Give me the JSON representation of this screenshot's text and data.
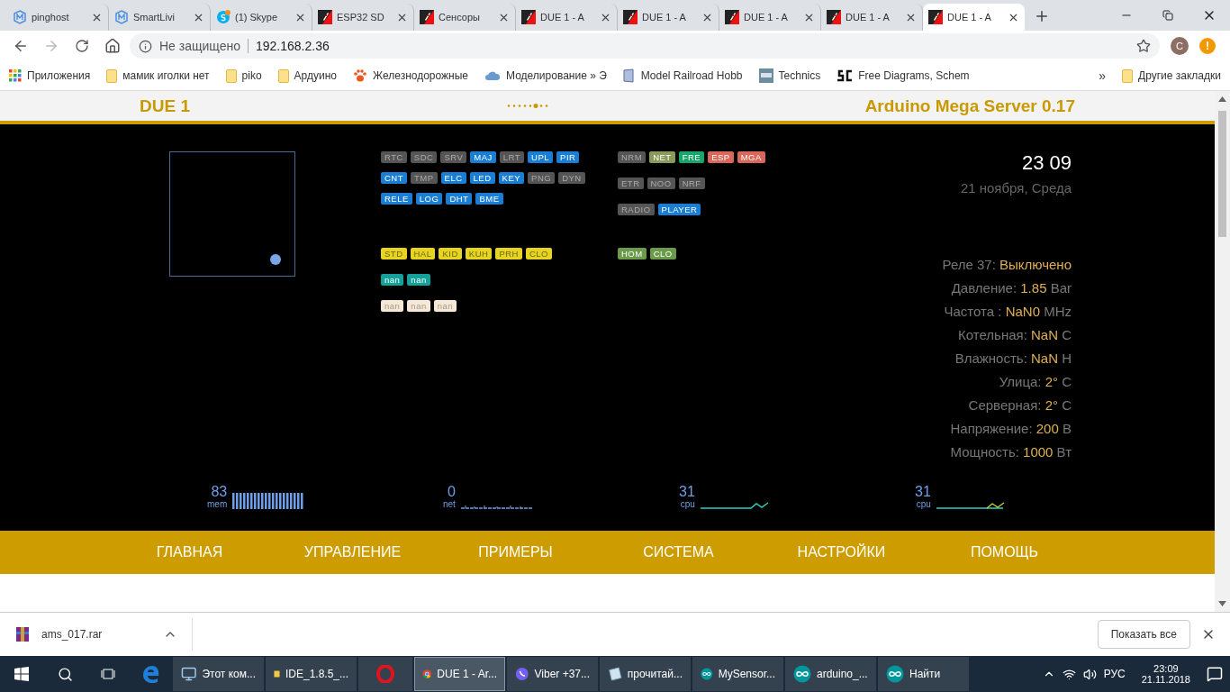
{
  "browser": {
    "tabs": [
      {
        "title": "pinghost",
        "kind": "m",
        "selected": false
      },
      {
        "title": "SmartLivi",
        "kind": "m",
        "selected": false
      },
      {
        "title": "(1) Skype",
        "kind": "skype",
        "selected": false
      },
      {
        "title": "ESP32 SD",
        "kind": "ams",
        "selected": false
      },
      {
        "title": "Сенсоры",
        "kind": "ams",
        "selected": false
      },
      {
        "title": "DUE 1 - A",
        "kind": "ams",
        "selected": false
      },
      {
        "title": "DUE 1 - A",
        "kind": "ams",
        "selected": false
      },
      {
        "title": "DUE 1 - A",
        "kind": "ams",
        "selected": false
      },
      {
        "title": "DUE 1 - A",
        "kind": "ams",
        "selected": false
      },
      {
        "title": "DUE 1 - A",
        "kind": "ams",
        "selected": true
      }
    ],
    "security": "Не защищено",
    "url": "192.168.2.36",
    "avatar": "C",
    "alert": "!",
    "bookmarks": [
      {
        "label": "Приложения",
        "kind": "apps"
      },
      {
        "label": "мамик иголки нет",
        "kind": "folder"
      },
      {
        "label": "piko",
        "kind": "folder"
      },
      {
        "label": "Ардуино",
        "kind": "folder"
      },
      {
        "label": "Железнодорожные",
        "kind": "paw"
      },
      {
        "label": "Моделирование » Э",
        "kind": "cloud"
      },
      {
        "label": "Model Railroad Hobb",
        "kind": "doc"
      },
      {
        "label": "Technics",
        "kind": "tac"
      },
      {
        "label": "Free Diagrams, Schem",
        "kind": "sc"
      }
    ],
    "more_bookmarks": "»",
    "other_bookmarks": "Другие закладки"
  },
  "page": {
    "header": {
      "left": "DUE 1",
      "right": "Arduino Mega Server 0.17"
    },
    "left_badges": {
      "status_rows": [
        [
          {
            "label": "RTC",
            "color": "#555555"
          },
          {
            "label": "SDC",
            "color": "#555555"
          },
          {
            "label": "SRV",
            "color": "#555555"
          },
          {
            "label": "MAJ",
            "color": "#1a7fd4"
          },
          {
            "label": "LRT",
            "color": "#555555"
          },
          {
            "label": "UPL",
            "color": "#1a7fd4"
          },
          {
            "label": "PIR",
            "color": "#1a7fd4"
          }
        ],
        [
          {
            "label": "CNT",
            "color": "#1a7fd4"
          },
          {
            "label": "TMP",
            "color": "#555555"
          },
          {
            "label": "ELC",
            "color": "#1a7fd4"
          },
          {
            "label": "LED",
            "color": "#1a7fd4"
          },
          {
            "label": "KEY",
            "color": "#1a7fd4"
          },
          {
            "label": "PNG",
            "color": "#555555"
          },
          {
            "label": "DYN",
            "color": "#555555"
          }
        ],
        [
          {
            "label": "RELE",
            "color": "#1a7fd4"
          },
          {
            "label": "LOG",
            "color": "#1a7fd4"
          },
          {
            "label": "DHT",
            "color": "#1a7fd4"
          },
          {
            "label": "BME",
            "color": "#1a7fd4"
          }
        ]
      ],
      "sensor_rows": [
        [
          {
            "label": "STD",
            "color": "#e6d420"
          },
          {
            "label": "HAL",
            "color": "#e6d420"
          },
          {
            "label": "KID",
            "color": "#e6d420"
          },
          {
            "label": "KUH",
            "color": "#e6d420"
          },
          {
            "label": "PRH",
            "color": "#e6d420"
          },
          {
            "label": "CLO",
            "color": "#e6d420"
          }
        ],
        [
          {
            "label": "nan",
            "color": "#13a19a"
          },
          {
            "label": "nan",
            "color": "#13a19a"
          }
        ],
        [
          {
            "label": "nan",
            "color": "#f5e8d6"
          },
          {
            "label": "nan",
            "color": "#f5e8d6"
          },
          {
            "label": "nan",
            "color": "#f5e8d6"
          }
        ]
      ]
    },
    "right_badges": {
      "status_rows": [
        [
          {
            "label": "NRM",
            "color": "#555555"
          },
          {
            "label": "NET",
            "color": "#8a9a5b"
          },
          {
            "label": "FRE",
            "color": "#19a66c"
          },
          {
            "label": "ESP",
            "color": "#d9675a"
          },
          {
            "label": "MGA",
            "color": "#d9675a"
          }
        ],
        [
          {
            "label": "ETR",
            "color": "#555555"
          },
          {
            "label": "NOO",
            "color": "#555555"
          },
          {
            "label": "NRF",
            "color": "#555555"
          }
        ],
        [
          {
            "label": "RADIO",
            "color": "#555555"
          },
          {
            "label": "PLAYER",
            "color": "#1a7fd4"
          }
        ]
      ],
      "sensor_rows": [
        [
          {
            "label": "HOM",
            "color": "#6a9a4a"
          },
          {
            "label": "CLO",
            "color": "#6a9a4a"
          }
        ]
      ]
    },
    "clock": "23 09",
    "date": "21 ноября, Среда",
    "readings": [
      {
        "label": "Реле 37:",
        "value": "Выключено"
      },
      {
        "label": "Давление:",
        "value": "1.85",
        "unit": "Bar"
      },
      {
        "label": "Частота :",
        "value": "NaN0",
        "unit": "MHz"
      },
      {
        "label": "Котельная:",
        "value": "NaN",
        "unit": "C"
      },
      {
        "label": "Влажность:",
        "value": "NaN",
        "unit": "H"
      },
      {
        "label": "Улица:",
        "value": "2°",
        "unit": "C"
      },
      {
        "label": "Серверная:",
        "value": "2°",
        "unit": "C"
      },
      {
        "label": "Напряжение:",
        "value": "200",
        "unit": "В"
      },
      {
        "label": "Мощность:",
        "value": "1000",
        "unit": "Вт"
      }
    ],
    "meters": [
      {
        "value": "83",
        "label": "mem",
        "kind": "bars"
      },
      {
        "value": "0",
        "label": "net",
        "kind": "ticks"
      },
      {
        "value": "31",
        "label": "cpu",
        "kind": "line"
      },
      {
        "value": "31",
        "label": "cpu",
        "kind": "line2"
      }
    ],
    "menu": [
      "ГЛАВНАЯ",
      "УПРАВЛЕНИЕ",
      "ПРИМЕРЫ",
      "СИСТЕМА",
      "НАСТРОЙКИ",
      "ПОМОЩЬ"
    ]
  },
  "downloads": {
    "file": "ams_017.rar",
    "show_all": "Показать все"
  },
  "taskbar": {
    "apps": [
      {
        "label": "Этот ком...",
        "kind": "pc",
        "selected": false
      },
      {
        "label": "IDE_1.8.5_...",
        "kind": "folder",
        "selected": false
      },
      {
        "kind": "opera",
        "selected": false
      },
      {
        "label": "DUE 1 - Ar...",
        "kind": "chrome",
        "selected": true
      },
      {
        "label": "Viber +37...",
        "kind": "viber",
        "selected": false
      },
      {
        "label": "прочитай...",
        "kind": "notepad",
        "selected": false
      },
      {
        "label": "MySensor...",
        "kind": "arduino",
        "selected": false
      },
      {
        "label": "arduino_...",
        "kind": "arduino",
        "selected": false
      },
      {
        "label": "Найти",
        "kind": "arduino",
        "selected": false
      }
    ],
    "language": "РУС",
    "time": "23:09",
    "date": "21.11.2018"
  }
}
